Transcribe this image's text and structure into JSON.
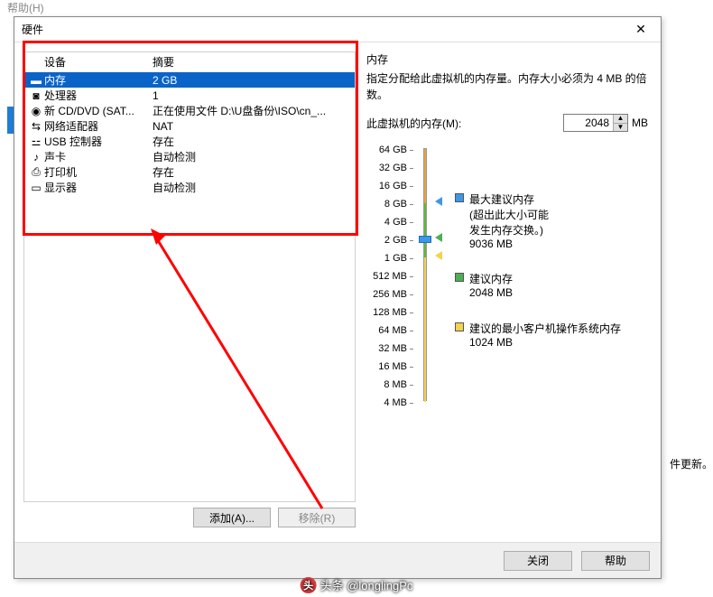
{
  "bg_text": "帮助(H)",
  "bg_side": "件更新。",
  "dialog": {
    "title": "硬件",
    "close": "✕"
  },
  "device_table": {
    "headers": {
      "device": "设备",
      "summary": "摘要"
    },
    "rows": [
      {
        "device": "内存",
        "summary": "2 GB",
        "icon": "memory-icon",
        "selected": true
      },
      {
        "device": "处理器",
        "summary": "1",
        "icon": "cpu-icon"
      },
      {
        "device": "新 CD/DVD (SAT...",
        "summary": "正在使用文件 D:\\U盘备份\\ISO\\cn_...",
        "icon": "cd-icon"
      },
      {
        "device": "网络适配器",
        "summary": "NAT",
        "icon": "network-icon"
      },
      {
        "device": "USB 控制器",
        "summary": "存在",
        "icon": "usb-icon"
      },
      {
        "device": "声卡",
        "summary": "自动检测",
        "icon": "sound-icon"
      },
      {
        "device": "打印机",
        "summary": "存在",
        "icon": "printer-icon"
      },
      {
        "device": "显示器",
        "summary": "自动检测",
        "icon": "display-icon"
      }
    ]
  },
  "buttons": {
    "add": "添加(A)...",
    "remove": "移除(R)"
  },
  "memory": {
    "label": "内存",
    "desc": "指定分配给此虚拟机的内存量。内存大小必须为 4 MB 的倍数。",
    "input_label": "此虚拟机的内存(M):",
    "value": "2048",
    "unit": "MB"
  },
  "ticks": [
    "64 GB",
    "32 GB",
    "16 GB",
    "8 GB",
    "4 GB",
    "2 GB",
    "1 GB",
    "512 MB",
    "256 MB",
    "128 MB",
    "64 MB",
    "32 MB",
    "16 MB",
    "8 MB",
    "4 MB"
  ],
  "legend": {
    "max": {
      "title": "最大建议内存",
      "sub1": "(超出此大小可能",
      "sub2": "发生内存交换。)",
      "val": "9036 MB",
      "color": "#3b97e8"
    },
    "rec": {
      "title": "建议内存",
      "val": "2048 MB",
      "color": "#4caf50"
    },
    "min": {
      "title": "建议的最小客户机操作系统内存",
      "val": "1024 MB",
      "color": "#f3d34b"
    }
  },
  "footer": {
    "close": "关闭",
    "help": "帮助"
  },
  "watermark": "头条 @longlingPc"
}
